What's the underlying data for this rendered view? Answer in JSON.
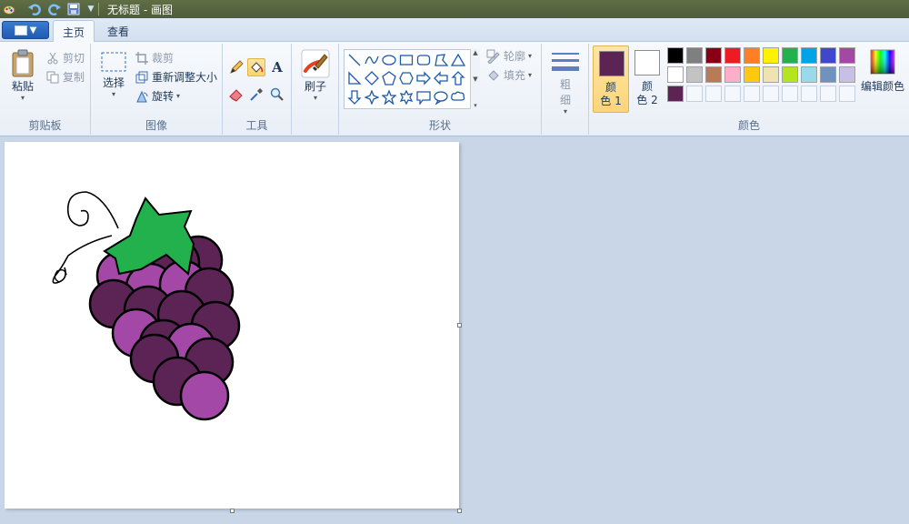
{
  "window": {
    "title": "无标题 - 画图"
  },
  "tabs": [
    {
      "label": "主页",
      "active": true
    },
    {
      "label": "查看",
      "active": false
    }
  ],
  "clipboard": {
    "paste_label": "粘贴",
    "cut_label": "剪切",
    "copy_label": "复制",
    "group_label": "剪贴板"
  },
  "image": {
    "select_label": "选择",
    "crop_label": "裁剪",
    "resize_label": "重新调整大小",
    "rotate_label": "旋转",
    "group_label": "图像"
  },
  "tools": {
    "group_label": "工具",
    "text_label": "A",
    "selected": "fill-tool"
  },
  "brushes": {
    "label": "刷子"
  },
  "shapes": {
    "group_label": "形状",
    "outline_label": "轮廓",
    "fill_label": "填充"
  },
  "size": {
    "label_line1": "粗",
    "label_line2": "细"
  },
  "colors": {
    "group_label": "颜色",
    "color1_line1": "颜",
    "color1_line2": "色 1",
    "color2_line1": "颜",
    "color2_line2": "色 2",
    "edit_label": "编辑颜色",
    "color1": "#5b2455",
    "color2": "#ffffff",
    "palette_row1": [
      "#000000",
      "#7f7f7f",
      "#880015",
      "#ed1c24",
      "#ff7f27",
      "#fff200",
      "#22b14c",
      "#00a2e8",
      "#3f48cc",
      "#a349a4"
    ],
    "palette_row2": [
      "#ffffff",
      "#c3c3c3",
      "#b97a57",
      "#ffaec9",
      "#ffc90e",
      "#efe4b0",
      "#b5e61d",
      "#99d9ea",
      "#7092be",
      "#c8bfe7"
    ],
    "custom_row": [
      "#5b2455",
      "",
      "",
      "",
      "",
      "",
      "",
      "",
      "",
      ""
    ]
  },
  "drawing": {
    "grape_dark": "#5b2455",
    "grape_light": "#a348a6",
    "leaf": "#22b14c",
    "outline": "#000000"
  }
}
